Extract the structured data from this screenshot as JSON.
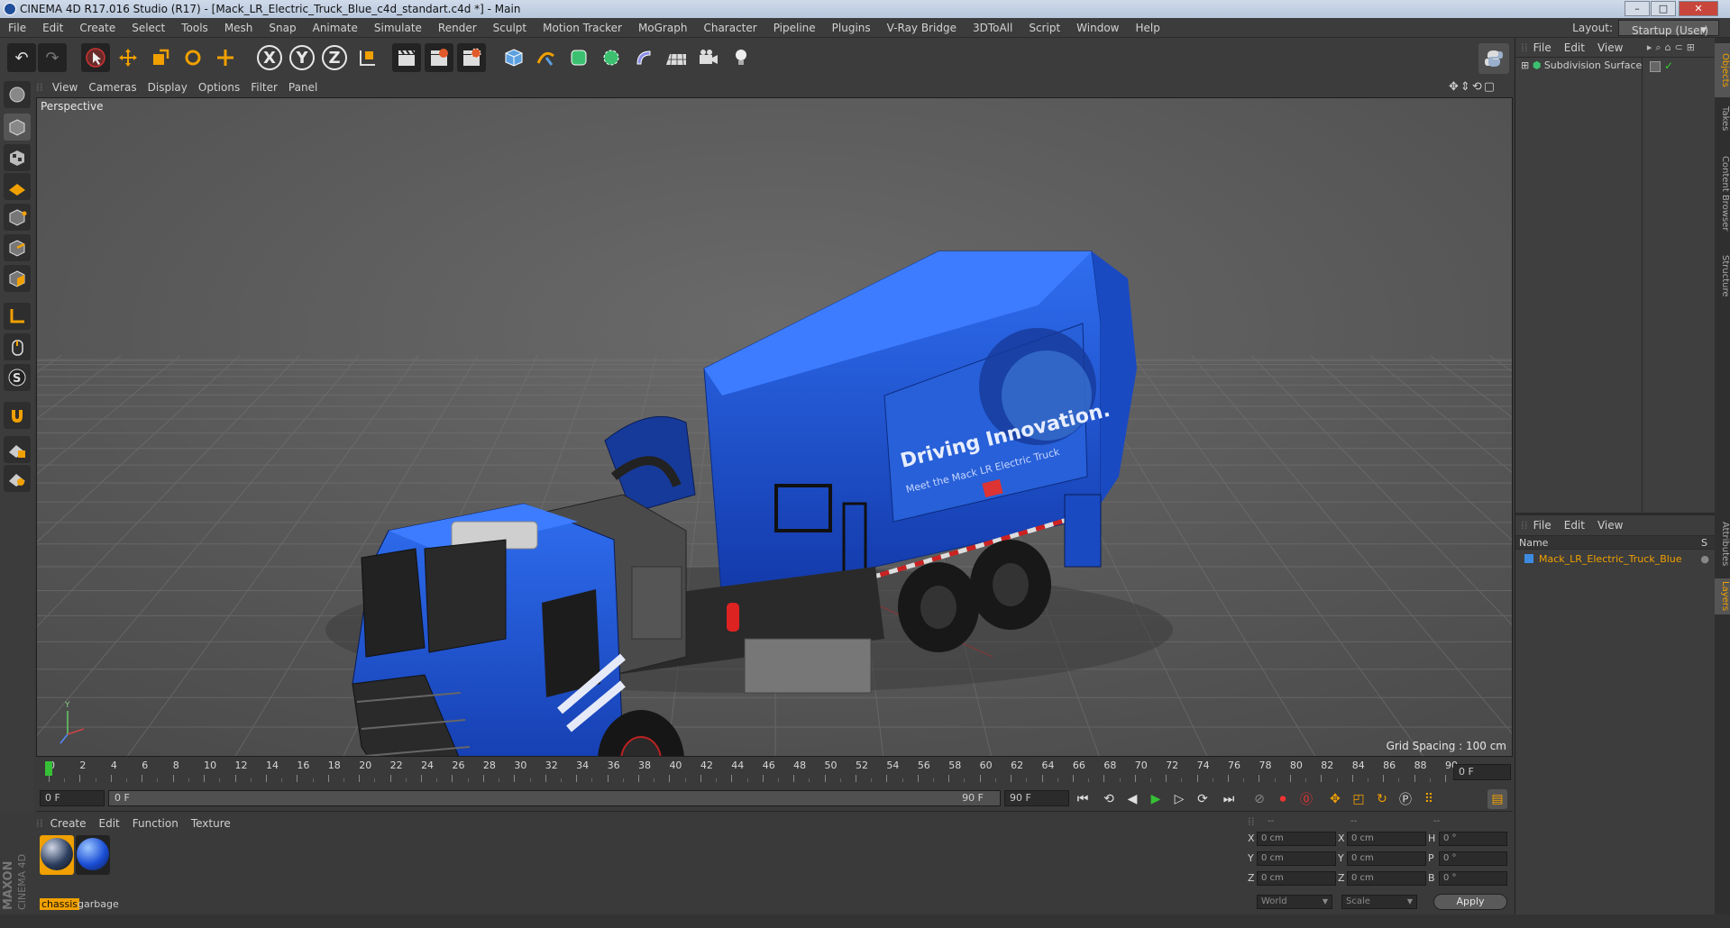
{
  "window": {
    "title": "CINEMA 4D R17.016 Studio (R17) - [Mack_LR_Electric_Truck_Blue_c4d_standart.c4d *] - Main",
    "minimize": "–",
    "maximize": "□",
    "close": "✕"
  },
  "menubar": {
    "items": [
      "File",
      "Edit",
      "Create",
      "Select",
      "Tools",
      "Mesh",
      "Snap",
      "Animate",
      "Simulate",
      "Render",
      "Sculpt",
      "Motion Tracker",
      "MoGraph",
      "Character",
      "Pipeline",
      "Plugins",
      "V-Ray Bridge",
      "3DToAll",
      "Script",
      "Window",
      "Help"
    ],
    "layout_label": "Layout:",
    "layout_value": "Startup (User)"
  },
  "toolbar": {
    "undo": "↶",
    "redo": "↷",
    "axis_x": "X",
    "axis_y": "Y",
    "axis_z": "Z"
  },
  "viewport": {
    "menu": [
      "View",
      "Cameras",
      "Display",
      "Options",
      "Filter",
      "Panel"
    ],
    "label": "Perspective",
    "grid_spacing": "Grid Spacing : 100 cm",
    "truck_banner": "Driving Innovation.",
    "truck_subline": "Meet the Mack LR Electric Truck"
  },
  "timeline": {
    "ticks": [
      "0",
      "2",
      "4",
      "6",
      "8",
      "10",
      "12",
      "14",
      "16",
      "18",
      "20",
      "22",
      "24",
      "26",
      "28",
      "30",
      "32",
      "34",
      "36",
      "38",
      "40",
      "42",
      "44",
      "46",
      "48",
      "50",
      "52",
      "54",
      "56",
      "58",
      "60",
      "62",
      "64",
      "66",
      "68",
      "70",
      "72",
      "74",
      "76",
      "78",
      "80",
      "82",
      "84",
      "86",
      "88",
      "90"
    ],
    "current_frame_right": "0 F",
    "start_field": "0 F",
    "range_start": "0 F",
    "range_end": "90 F",
    "end_field": "90 F"
  },
  "material_manager": {
    "menu": [
      "Create",
      "Edit",
      "Function",
      "Texture"
    ],
    "materials": [
      {
        "name": "chassis",
        "selected": true
      },
      {
        "name": "garbage",
        "selected": false
      }
    ]
  },
  "coordinates": {
    "headers": [
      "--",
      "--",
      "--"
    ],
    "rows": [
      {
        "axis": "X",
        "pos": "0 cm",
        "axis2": "X",
        "size": "0 cm",
        "rot_label": "H",
        "rot": "0 °"
      },
      {
        "axis": "Y",
        "pos": "0 cm",
        "axis2": "Y",
        "size": "0 cm",
        "rot_label": "P",
        "rot": "0 °"
      },
      {
        "axis": "Z",
        "pos": "0 cm",
        "axis2": "Z",
        "size": "0 cm",
        "rot_label": "B",
        "rot": "0 °"
      }
    ],
    "mode_world": "World",
    "mode_scale": "Scale",
    "apply": "Apply"
  },
  "object_manager": {
    "menu": [
      "File",
      "Edit",
      "View"
    ],
    "objects": [
      {
        "name": "Subdivision Surface"
      }
    ]
  },
  "layer_manager": {
    "menu": [
      "File",
      "Edit",
      "View"
    ],
    "col_name": "Name",
    "col_s": "S",
    "layers": [
      {
        "name": "Mack_LR_Electric_Truck_Blue",
        "color": "#3d8be0"
      }
    ]
  },
  "side_tabs": {
    "top": [
      "Objects",
      "Takes",
      "Content Browser",
      "Structure"
    ],
    "bottom": [
      "Attributes",
      "Layers"
    ]
  },
  "branding": {
    "maxon": "MAXON",
    "cinema": "CINEMA 4D"
  },
  "colors": {
    "accent_orange": "#f0a000",
    "play_green": "#36c036",
    "truck_blue": "#1b4fd6"
  }
}
